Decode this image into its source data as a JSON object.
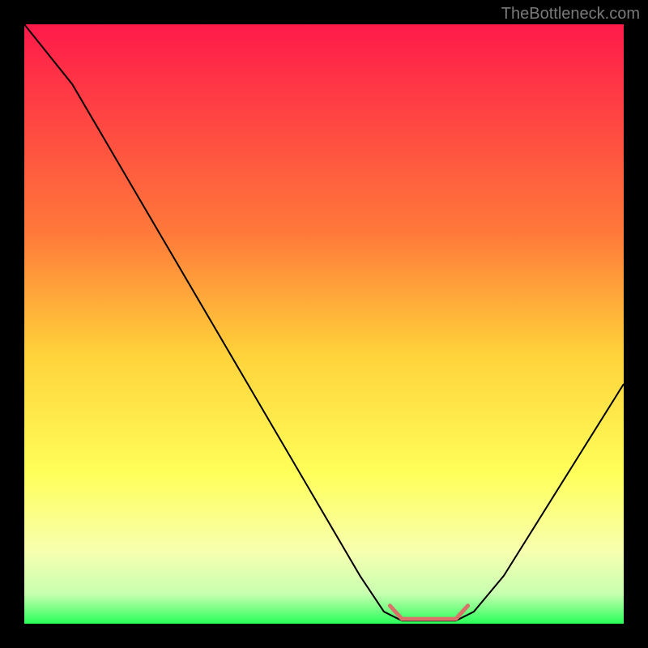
{
  "watermark": "TheBottleneck.com",
  "chart_data": {
    "type": "line",
    "title": "",
    "xlabel": "",
    "ylabel": "",
    "xlim": [
      0,
      100
    ],
    "ylim": [
      0,
      100
    ],
    "gradient_stops": [
      {
        "offset": 0,
        "color": "#ff1a4a"
      },
      {
        "offset": 35,
        "color": "#ff7a3a"
      },
      {
        "offset": 55,
        "color": "#ffd23a"
      },
      {
        "offset": 75,
        "color": "#ffff5a"
      },
      {
        "offset": 88,
        "color": "#f7ffb0"
      },
      {
        "offset": 95,
        "color": "#c8ffb0"
      },
      {
        "offset": 100,
        "color": "#2aff5a"
      }
    ],
    "series": [
      {
        "name": "bottleneck-curve",
        "color": "#000000",
        "points": [
          {
            "x": 0,
            "y": 100
          },
          {
            "x": 4,
            "y": 95
          },
          {
            "x": 8,
            "y": 90
          },
          {
            "x": 56,
            "y": 8
          },
          {
            "x": 60,
            "y": 2
          },
          {
            "x": 63,
            "y": 0.5
          },
          {
            "x": 72,
            "y": 0.5
          },
          {
            "x": 75,
            "y": 2
          },
          {
            "x": 80,
            "y": 8
          },
          {
            "x": 100,
            "y": 40
          }
        ]
      },
      {
        "name": "optimal-range-marker",
        "color": "#d9726a",
        "width": 5,
        "points": [
          {
            "x": 61,
            "y": 3
          },
          {
            "x": 63,
            "y": 0.8
          },
          {
            "x": 72,
            "y": 0.8
          },
          {
            "x": 74,
            "y": 3
          }
        ]
      }
    ]
  }
}
